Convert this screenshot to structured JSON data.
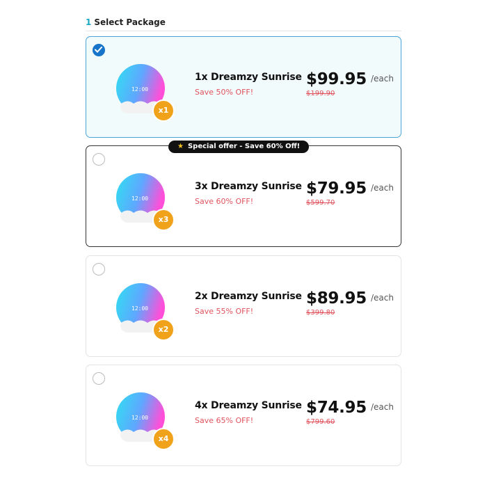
{
  "section": {
    "number": "1",
    "title": "Select Package"
  },
  "packages": [
    {
      "name": "1x Dreamzy Sunrise",
      "save": "Save 50% OFF!",
      "price": "$99.95",
      "per": "/each",
      "old_price": "$199.90",
      "qty": "x1",
      "selected": true
    },
    {
      "name": "3x Dreamzy Sunrise",
      "save": "Save 60% OFF!",
      "price": "$79.95",
      "per": "/each",
      "old_price": "$599.70",
      "qty": "x3",
      "featured": true,
      "badge": "Special offer - Save 60% Off!"
    },
    {
      "name": "2x Dreamzy Sunrise",
      "save": "Save 55% OFF!",
      "price": "$89.95",
      "per": "/each",
      "old_price": "$399.80",
      "qty": "x2"
    },
    {
      "name": "4x Dreamzy Sunrise",
      "save": "Save 65% OFF!",
      "price": "$74.95",
      "per": "/each",
      "old_price": "$799.60",
      "qty": "x4"
    }
  ],
  "colors": {
    "accent": "#17a7c4",
    "selected_radio": "#1775c9",
    "badge": "#f0a21b",
    "save_text": "#e0535d"
  },
  "icons": {
    "radio_checked": "check-icon",
    "badge_star": "star-icon"
  }
}
